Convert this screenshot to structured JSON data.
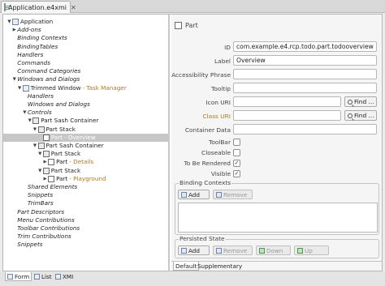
{
  "editor_tab": {
    "title": "Application.e4xmi",
    "close": "✕"
  },
  "tree": [
    {
      "label": "Application",
      "depth": 0,
      "twisty": "open",
      "icon": "app",
      "italic": false
    },
    {
      "label": "Add-ons",
      "depth": 1,
      "twisty": "closed",
      "italic": true
    },
    {
      "label": "Binding Contexts",
      "depth": 1,
      "italic": true
    },
    {
      "label": "BindingTables",
      "depth": 1,
      "italic": true
    },
    {
      "label": "Handlers",
      "depth": 1,
      "italic": true
    },
    {
      "label": "Commands",
      "depth": 1,
      "italic": true
    },
    {
      "label": "Command Categories",
      "depth": 1,
      "italic": true
    },
    {
      "label": "Windows and Dialogs",
      "depth": 1,
      "twisty": "open",
      "italic": true
    },
    {
      "label": "Trimmed Window",
      "suffix": " - Task Manager",
      "depth": 2,
      "twisty": "open",
      "icon": "app",
      "italic": false
    },
    {
      "label": "Handlers",
      "depth": 3,
      "italic": true
    },
    {
      "label": "Windows and Dialogs",
      "depth": 3,
      "italic": true
    },
    {
      "label": "Controls",
      "depth": 3,
      "twisty": "open",
      "italic": true
    },
    {
      "label": "Part Sash Container",
      "depth": 4,
      "twisty": "open",
      "icon": "stack",
      "italic": false
    },
    {
      "label": "Part Stack",
      "depth": 5,
      "twisty": "open",
      "icon": "stack",
      "italic": false
    },
    {
      "label": "Part",
      "suffix": " - Overview",
      "depth": 6,
      "icon": "part",
      "italic": false,
      "selected": true
    },
    {
      "label": "Part Sash Container",
      "depth": 5,
      "twisty": "open",
      "icon": "stack",
      "italic": false
    },
    {
      "label": "Part Stack",
      "depth": 6,
      "twisty": "open",
      "icon": "stack",
      "italic": false
    },
    {
      "label": "Part",
      "suffix": " - Details",
      "depth": 7,
      "twisty": "closed",
      "icon": "part",
      "italic": false
    },
    {
      "label": "Part Stack",
      "depth": 6,
      "twisty": "open",
      "icon": "stack",
      "italic": false
    },
    {
      "label": "Part",
      "suffix": " - Playground",
      "depth": 7,
      "twisty": "closed",
      "icon": "part",
      "italic": false
    },
    {
      "label": "Shared Elements",
      "depth": 3,
      "italic": true
    },
    {
      "label": "Snippets",
      "depth": 3,
      "italic": true
    },
    {
      "label": "TrimBars",
      "depth": 3,
      "italic": true
    },
    {
      "label": "Part Descriptors",
      "depth": 1,
      "italic": true
    },
    {
      "label": "Menu Contributions",
      "depth": 1,
      "italic": true
    },
    {
      "label": "Toolbar Contributions",
      "depth": 1,
      "italic": true
    },
    {
      "label": "Trim Contributions",
      "depth": 1,
      "italic": true
    },
    {
      "label": "Snippets",
      "depth": 1,
      "italic": true
    }
  ],
  "form": {
    "title": "Part",
    "id_label": "ID",
    "id_value": "com.example.e4.rcp.todo.part.todooverview",
    "label_label": "Label",
    "label_value": "Overview",
    "accessibility_label": "Accessibility Phrase",
    "accessibility_value": "",
    "tooltip_label": "Tooltip",
    "tooltip_value": "",
    "icon_uri_label": "Icon URI",
    "icon_uri_value": "",
    "class_uri_label": "Class URI",
    "class_uri_value": "",
    "container_data_label": "Container Data",
    "container_data_value": "",
    "find_label": "Find ...",
    "toolbar_label": "ToolBar",
    "toolbar_checked": false,
    "closeable_label": "Closeable",
    "closeable_checked": false,
    "to_be_rendered_label": "To Be Rendered",
    "to_be_rendered_checked": true,
    "visible_label": "Visible",
    "visible_checked": true,
    "binding_contexts": {
      "title": "Binding Contexts",
      "add": "Add",
      "remove": "Remove"
    },
    "persisted_state": {
      "title": "Persisted State",
      "add": "Add",
      "remove": "Remove",
      "down": "Down",
      "up": "Up"
    },
    "tabs": [
      "Default",
      "Supplementary"
    ]
  },
  "bottom_tabs": [
    "Form",
    "List",
    "XMI"
  ]
}
